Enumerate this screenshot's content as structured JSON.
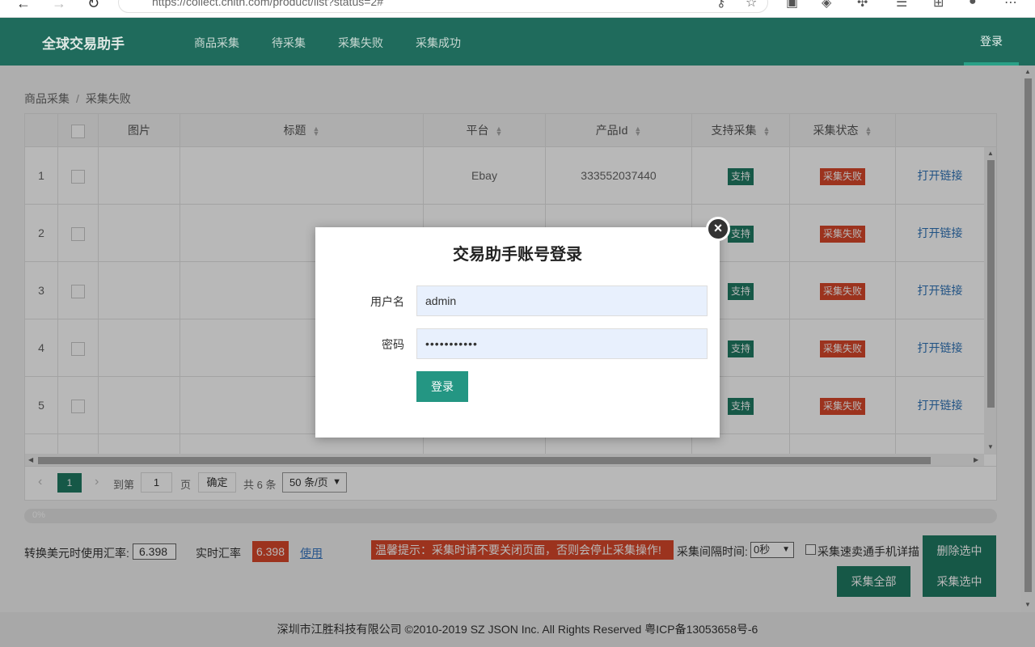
{
  "browser": {
    "url": "https://collect.chitn.com/product/list?status=2#"
  },
  "header": {
    "logo": "全球交易助手",
    "nav": [
      "商品采集",
      "待采集",
      "采集失败",
      "采集成功"
    ],
    "login": "登录"
  },
  "breadcrumb": {
    "root": "商品采集",
    "sep": "/",
    "current": "采集失败"
  },
  "table": {
    "headers": {
      "image": "图片",
      "title": "标题",
      "platform": "平台",
      "product_id": "产品Id",
      "support": "支持采集",
      "status": "采集状态"
    },
    "rows": [
      {
        "index": "1",
        "platform": "Ebay",
        "product_id": "333552037440",
        "support": "支持",
        "status": "采集失败",
        "action": "打开链接"
      },
      {
        "index": "2",
        "platform": "",
        "product_id": "",
        "support": "支持",
        "status": "采集失败",
        "action": "打开链接"
      },
      {
        "index": "3",
        "platform": "",
        "product_id": "",
        "support": "支持",
        "status": "采集失败",
        "action": "打开链接"
      },
      {
        "index": "4",
        "platform": "",
        "product_id": "",
        "support": "支持",
        "status": "采集失败",
        "action": "打开链接"
      },
      {
        "index": "5",
        "platform": "",
        "product_id": "",
        "support": "支持",
        "status": "采集失败",
        "action": "打开链接"
      }
    ]
  },
  "pager": {
    "current": "1",
    "goto_label": "到第",
    "goto_value": "1",
    "page_unit": "页",
    "confirm": "确定",
    "total": "共 6 条",
    "per_page": "50 条/页"
  },
  "progress": {
    "label": "0%",
    "value": 0
  },
  "controls": {
    "rate_label": "转换美元时使用汇率:",
    "rate_value": "6.398",
    "real_rate_label": "实时汇率",
    "real_rate_value": "6.398",
    "use_link": "使用",
    "warning": "温馨提示：采集时请不要关闭页面，否则会停止采集操作!",
    "interval_label": "采集间隔时间:",
    "interval_value": "0秒",
    "fast_label": "采集速卖通手机详描",
    "delete_selected": "删除选中",
    "collect_all": "采集全部",
    "collect_selected": "采集选中"
  },
  "footer": {
    "text": "深圳市江胜科技有限公司 ©2010-2019 SZ JSON Inc. All Rights Reserved 粤ICP备13053658号-6"
  },
  "modal": {
    "title": "交易助手账号登录",
    "username_label": "用户名",
    "username_value": "admin",
    "password_label": "密码",
    "password_value": "•••••••••••",
    "submit": "登录"
  },
  "colors": {
    "header_bg": "#1f6b5c",
    "primary": "#1f7a63",
    "danger": "#d9472a",
    "link": "#2f73b8"
  }
}
